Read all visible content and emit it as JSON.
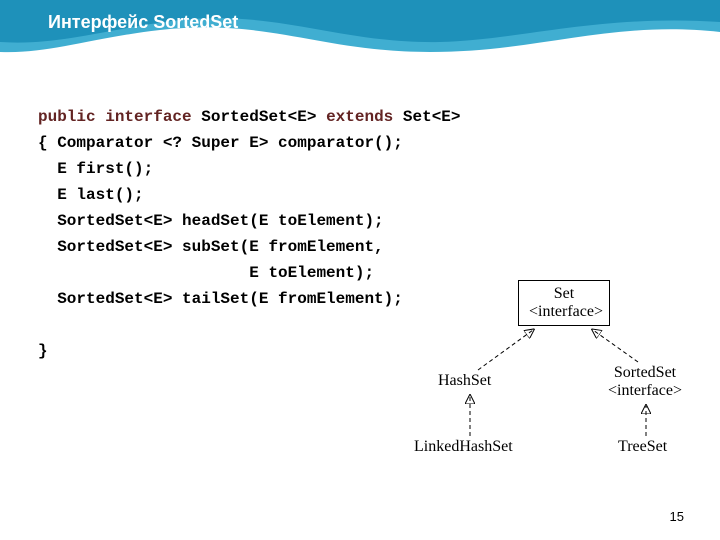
{
  "title": "Интерфейс SortedSet",
  "code": {
    "l1": {
      "kw1": "public",
      "kw2": "interface",
      "name": " SortedSet<E> ",
      "kw3": "extends",
      "tail": " Set<E>"
    },
    "l2": "{ Comparator <? Super E> comparator();",
    "l3": "  E first();",
    "l4": "  E last();",
    "l5": "  SortedSet<E> headSet(E toElement);",
    "l6": "  SortedSet<E> subSet(E fromElement,",
    "l7": "                      E toElement);",
    "l8": "  SortedSet<E> tailSet(E fromElement);",
    "l9": "}"
  },
  "diagram": {
    "set": "Set",
    "iface": "<interface>",
    "hashset": "HashSet",
    "sortedset": "SortedSet",
    "linkedhashset": "LinkedHashSet",
    "treeset": "TreeSet"
  },
  "page_number": "15"
}
